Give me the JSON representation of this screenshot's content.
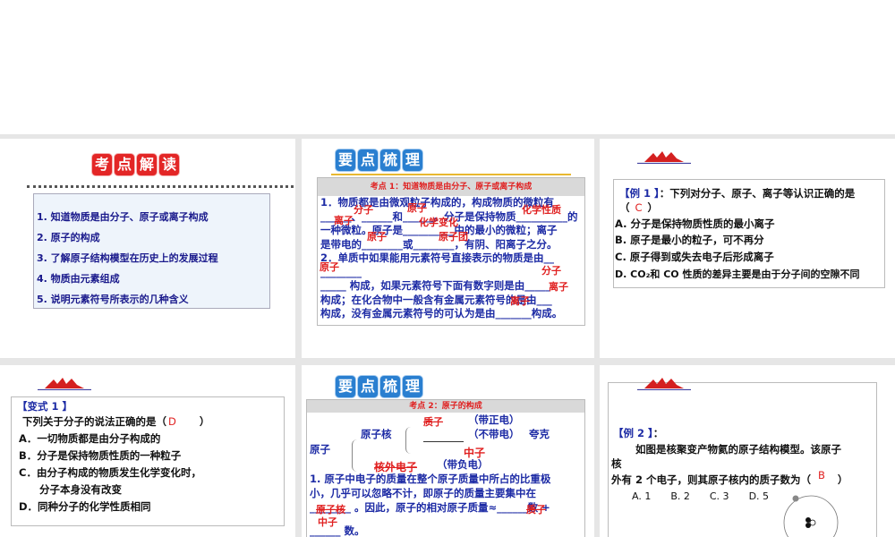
{
  "slide1": {
    "title_chars": [
      "考",
      "点",
      "解",
      "读"
    ],
    "items": [
      "1. 知道物质是由分子、原子或离子构成",
      "2. 原子的构成",
      "3. 了解原子结构模型在历史上的发展过程",
      "4. 物质由元素组成",
      "5. 说明元素符号所表示的几种含义"
    ]
  },
  "slide2": {
    "title_chars": [
      "要",
      "点",
      "梳",
      "理"
    ],
    "header": "考点 1：知道物质是由分子、原子或离子构成",
    "lines": [
      "1．物质都是由微观粒子构成的，构成物质的微粒有",
      "______、______和______。分子是保持物质__________的",
      "一种微粒。原子是__________中的最小的微粒；离子",
      "是带电的________或________，有阴、阳离子之分。",
      "2．单质中如果能用元素符号直接表示的物质是由__",
      "________",
      "_____ 构成，如果元素符号下面有数字则是由_____",
      "构成；在化合物中一般含有金属元素符号的是由___",
      "构成，没有金属元素符号的可认为是由_______构成。"
    ],
    "answers": {
      "a1": "分子",
      "a2": "离子",
      "a3": "原子",
      "a4": "化学性质",
      "a5": "化学变化",
      "a6": "原子",
      "a7": "原子团",
      "a8": "原子",
      "a9": "分子",
      "a10": "离子",
      "a11": "离子"
    }
  },
  "slide3": {
    "label": "【例 1 】",
    "question": "：下列对分子、原子、离子等认识正确的是",
    "paren_open": "（",
    "answer": "C",
    "paren_close": "）",
    "options": [
      "A. 分子是保持物质性质的最小离子",
      "B. 原子是最小的粒子，可不再分",
      "C. 原子得到或失去电子后形成离子",
      "D. CO₂和 CO 性质的差异主要是由于分子间的空隙不同"
    ]
  },
  "slide4": {
    "label": "【变式 1 】",
    "question": "下列关于分子的说法正确的是（",
    "answer": "D",
    "paren_close": "）",
    "options": [
      "A．一切物质都是由分子构成的",
      "B．分子是保持物质性质的一种粒子",
      "C．由分子构成的物质发生化学变化时，",
      "　　分子本身没有改变",
      "D．同种分子的化学性质相同"
    ]
  },
  "slide5": {
    "title_chars": [
      "要",
      "点",
      "梳",
      "理"
    ],
    "header": "考点 2：原子的构成",
    "nucleus": "原子核",
    "atom": "原子",
    "pos": "（带正电）",
    "neutral": "（不带电）",
    "extra": "夸克",
    "neg": "（带负电）",
    "lines": [
      "1. 原子中电子的质量在整个原子质量中所占的比重极",
      "小，几乎可以忽略不计，即原子的质量主要集中在",
      "________ 。因此，原子的相对原子质量≈______数 +",
      "______ 数。"
    ],
    "answers": {
      "b1": "质子",
      "b2": "中子",
      "b3": "核外电子",
      "b4": "原子核",
      "b5": "质子",
      "b6": "中子"
    }
  },
  "slide6": {
    "label": "【例 2 】",
    "colon": "：",
    "q1": "如图是核聚变产物氦的原子结构模型。该原子",
    "q2": "核",
    "q3": "外有 2 个电子，则其原子核内的质子数为（",
    "answer": "B",
    "paren_close": "）",
    "options": [
      "A. 1",
      "B. 2",
      "C. 3",
      "D. 5"
    ]
  }
}
